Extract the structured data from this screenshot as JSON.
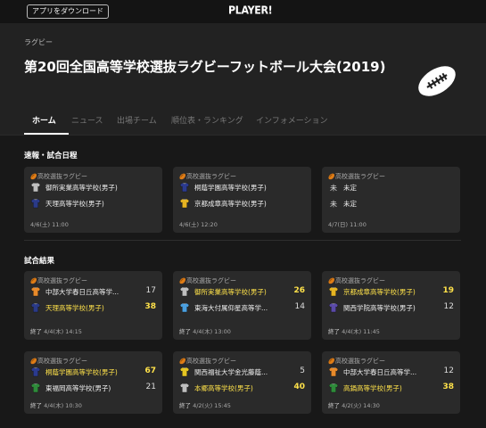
{
  "topbar": {
    "app_button": "アプリをダウンロード",
    "logo": "PLAYER!"
  },
  "header": {
    "category": "ラグビー",
    "title": "第20回全国高等学校選抜ラグビーフットボール大会(2019)"
  },
  "tabs": [
    {
      "label": "ホーム",
      "active": true
    },
    {
      "label": "ニュース"
    },
    {
      "label": "出場チーム"
    },
    {
      "label": "順位表・ランキング"
    },
    {
      "label": "インフォメーション"
    }
  ],
  "sections": {
    "upcoming": "速報・試合日程",
    "results": "試合結果"
  },
  "upcoming": [
    {
      "category": "高校選抜ラグビー",
      "home": {
        "name": "御所実業高等学校(男子)",
        "shirt": "#bfbfbf"
      },
      "away": {
        "name": "天理高等学校(男子)",
        "shirt": "#2a3a88"
      },
      "time": "4/6(土) 11:00"
    },
    {
      "category": "高校選抜ラグビー",
      "home": {
        "name": "桐蔭学園高等学校(男子)",
        "shirt": "#2b3b8f"
      },
      "away": {
        "name": "京都成章高等学校(男子)",
        "shirt": "#e6b422"
      },
      "time": "4/6(土) 12:20"
    },
    {
      "category": "高校選抜ラグビー",
      "home": {
        "name": "未定",
        "shirt": "tbd"
      },
      "away": {
        "name": "未定",
        "shirt": "tbd"
      },
      "time": "4/7(日) 11:00"
    }
  ],
  "results": [
    {
      "category": "高校選抜ラグビー",
      "home": {
        "name": "中部大学春日丘高等学...",
        "score": "17",
        "win": false,
        "shirt": "#e88a2a"
      },
      "away": {
        "name": "天理高等学校(男子)",
        "score": "38",
        "win": true,
        "shirt": "#2a3a88"
      },
      "status": "終了",
      "date": "4/4(木) 14:15"
    },
    {
      "category": "高校選抜ラグビー",
      "home": {
        "name": "御所実業高等学校(男子)",
        "score": "26",
        "win": true,
        "shirt": "#bfbfbf"
      },
      "away": {
        "name": "東海大付属仰星高等学...",
        "score": "14",
        "win": false,
        "shirt": "#4aa0e0"
      },
      "status": "終了",
      "date": "4/4(木) 13:00"
    },
    {
      "category": "高校選抜ラグビー",
      "home": {
        "name": "京都成章高等学校(男子)",
        "score": "19",
        "win": true,
        "shirt": "#e6b422"
      },
      "away": {
        "name": "関西学院高等学校(男子)",
        "score": "12",
        "win": false,
        "shirt": "#5a4aa8"
      },
      "status": "終了",
      "date": "4/4(木) 11:45"
    },
    {
      "category": "高校選抜ラグビー",
      "home": {
        "name": "桐蔭学園高等学校(男子)",
        "score": "67",
        "win": true,
        "shirt": "#2b3b8f"
      },
      "away": {
        "name": "東福岡高等学校(男子)",
        "score": "21",
        "win": false,
        "shirt": "#2e8b3a"
      },
      "status": "終了",
      "date": "4/4(木) 10:30"
    },
    {
      "category": "高校選抜ラグビー",
      "home": {
        "name": "関西福祉大学金光藤蔭...",
        "score": "5",
        "win": false,
        "shirt": "#e6c622"
      },
      "away": {
        "name": "本郷高等学校(男子)",
        "score": "40",
        "win": true,
        "shirt": "#bfbfbf"
      },
      "status": "終了",
      "date": "4/2(火) 15:45"
    },
    {
      "category": "高校選抜ラグビー",
      "home": {
        "name": "中部大学春日丘高等学...",
        "score": "12",
        "win": false,
        "shirt": "#e88a2a"
      },
      "away": {
        "name": "高鍋高等学校(男子)",
        "score": "38",
        "win": true,
        "shirt": "#2e8b3a"
      },
      "status": "終了",
      "date": "4/2(火) 14:30"
    }
  ]
}
